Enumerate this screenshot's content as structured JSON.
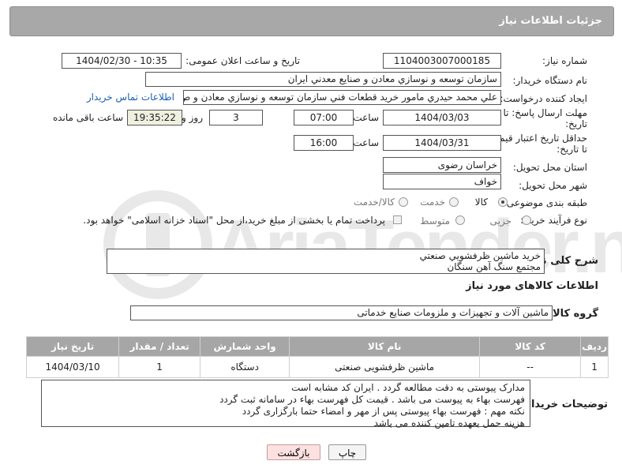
{
  "header": {
    "title": "جزئیات اطلاعات نیاز"
  },
  "fields": {
    "need_number_label": "شماره نیاز:",
    "need_number": "1104003007000185",
    "announce_label": "تاریخ و ساعت اعلان عمومی:",
    "announce_value": "1404/02/30 - 10:35",
    "buyer_org_label": "نام دستگاه خریدار:",
    "buyer_org": "سازمان توسعه و نوسازي معادن و صنايع معدني ايران",
    "creator_label": "ایجاد کننده درخواست:",
    "creator": "علي محمد حيدري مامور خريد قطعات فني سازمان توسعه و نوسازي معادن و ص",
    "contact_link": "اطلاعات تماس خریدار",
    "deadline_label_1": "مهلت ارسال پاسخ: تا",
    "deadline_label_2": "تاریخ:",
    "deadline_date": "1404/03/03",
    "time_label": "ساعت",
    "deadline_time": "07:00",
    "days_value": "3",
    "days_label": "روز و",
    "remaining_time": "19:35:22",
    "remaining_label": "ساعت باقی مانده",
    "price_label_1": "حداقل تاریخ اعتبار قیمت:",
    "price_label_2": "تا تاریخ:",
    "price_date": "1404/03/31",
    "price_time_label": "ساعت",
    "price_time": "16:00",
    "province_label": "استان محل تحویل:",
    "province": "خراسان رضوی",
    "city_label": "شهر محل تحویل:",
    "city": "خواف",
    "category_label": "طبقه بندی موضوعی:",
    "category_options": [
      "کالا",
      "خدمت",
      "کالا/خدمت"
    ],
    "process_label": "نوع فرآیند خرید :",
    "process_options": [
      "جزیی",
      "متوسط"
    ],
    "payment_note": "پرداخت تمام یا بخشی از مبلغ خرید،از محل \"اسناد خزانه اسلامی\" خواهد بود."
  },
  "description": {
    "label": "شرح کلی نیاز:",
    "line1": "خريد ماشين ظرفشويي صنعتي",
    "line2": "مجتمع سنگ آهن سنگان"
  },
  "goods": {
    "section_title": "اطلاعات کالاهای مورد نیاز",
    "group_label": "گروه کالا:",
    "group_value": "ماشین آلات و تجهیزات و ملزومات صنایع خدماتی"
  },
  "table": {
    "headers": [
      "ردیف",
      "کد کالا",
      "نام کالا",
      "واحد شمارش",
      "تعداد / مقدار",
      "تاریخ نیاز"
    ],
    "rows": [
      [
        "1",
        "--",
        "ماشین ظرفشویی صنعتی",
        "دستگاه",
        "1",
        "1404/03/10"
      ]
    ]
  },
  "notes": {
    "label": "توضیحات خریدار:",
    "line1": "مدارک پیوستی به دقت مطالعه گردد . ایران کد مشابه است",
    "line2": "فهرست بهاء به پیوست می باشد . قیمت کل فهرست بهاء در سامانه ثبت گردد",
    "line3": "نکته مهم : فهرست بهاء پیوستی پس از مهر و امضاء حتما بارگزاری گردد",
    "line4": "هزینه حمل بعهده تامین کننده می باشد"
  },
  "buttons": {
    "print": "چاپ",
    "back": "بازگشت"
  },
  "watermark": {
    "text": "AriaTender.neT"
  }
}
